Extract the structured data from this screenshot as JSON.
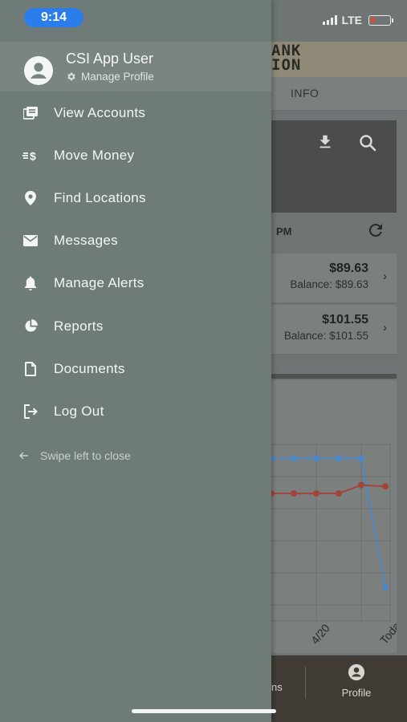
{
  "status_bar": {
    "time": "9:14",
    "network": "LTE"
  },
  "background_app": {
    "brand_lines": [
      "ANK",
      "ION"
    ],
    "tab_label": "INFO",
    "sync_time_fragment": "PM",
    "accounts": [
      {
        "amount": "$89.63",
        "balance": "Balance: $89.63"
      },
      {
        "amount": "$101.55",
        "balance": "Balance: $101.55"
      }
    ],
    "chart_data": {
      "type": "line",
      "categories": [
        "",
        "",
        "",
        "4/20",
        "",
        "Today"
      ],
      "tick_labels": [
        "4/20",
        "Today"
      ],
      "series": [
        {
          "color": "#4a86c8",
          "values": [
            100,
            100,
            100,
            100,
            100,
            100,
            8
          ]
        },
        {
          "color": "#a4433b",
          "values": [
            75,
            75,
            75,
            75,
            75,
            81,
            80
          ]
        }
      ]
    },
    "bottom_nav": {
      "prev_fragment": "ns",
      "profile_label": "Profile"
    }
  },
  "drawer": {
    "user_name": "CSI App User",
    "manage_profile": "Manage Profile",
    "menu": [
      {
        "label": "View Accounts",
        "icon": "accounts-icon"
      },
      {
        "label": "Move Money",
        "icon": "move-money-icon"
      },
      {
        "label": "Find Locations",
        "icon": "location-pin-icon"
      },
      {
        "label": "Messages",
        "icon": "mail-icon"
      },
      {
        "label": "Manage Alerts",
        "icon": "bell-icon"
      },
      {
        "label": "Reports",
        "icon": "pie-chart-icon"
      },
      {
        "label": "Documents",
        "icon": "document-icon"
      },
      {
        "label": "Log Out",
        "icon": "logout-icon"
      }
    ],
    "swipe_hint": "Swipe left to close"
  }
}
